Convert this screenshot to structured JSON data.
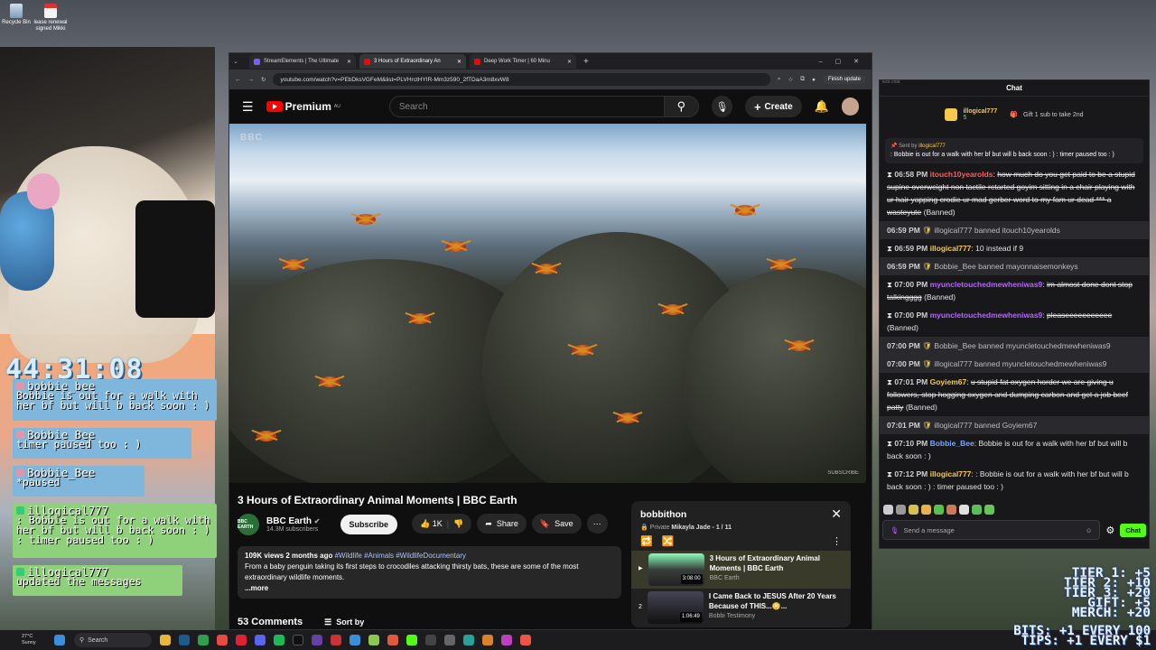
{
  "desktop": {
    "icons": [
      "Recycle Bin",
      "lease renewal signed Mikki"
    ]
  },
  "stream": {
    "timer": "44:31:08",
    "overlay_messages": [
      {
        "name": "bobbie_bee",
        "text": "Bobbie is out for a walk with her bf but will b back soon : )"
      },
      {
        "name": "Bobbie_Bee",
        "text": "timer paused too : )"
      },
      {
        "name": "Bobbie_Bee",
        "text": "*paused"
      },
      {
        "name": "illogical777",
        "text": ": Bobbie is out for a walk with her bf but will b back soon : ) : timer paused too : )"
      },
      {
        "name": "illogical777",
        "text": "updated the messages"
      }
    ],
    "tiers": [
      "TIER 1: +5",
      "TIER 2: +10",
      "TIER 3: +20",
      "GIFT: +5",
      "MERCH: +20"
    ],
    "bits": "BITS: +1 EVERY 100",
    "tips": "TIPS: +1 EVERY $1",
    "overlay_colors": {
      "blue": "#7fb6dc",
      "green": "#8fd07a"
    }
  },
  "browser": {
    "tabs": [
      {
        "label": "StreamElements | The Ultimate",
        "favcolor": "#7b5cff"
      },
      {
        "label": "3 Hours of Extraordinary An",
        "favcolor": "#ff0000"
      },
      {
        "label": "Deep Work Timer | 60 Minu",
        "favcolor": "#ff0000"
      }
    ],
    "url": "youtube.com/watch?v=PEbDksVGFeM&list=PLVHrctHYIR-Mm3z590_2fTDaA3m8xvW8",
    "finish_update": "Finish update"
  },
  "youtube": {
    "logo": "Premium",
    "region": "AU",
    "search_placeholder": "Search",
    "create_label": "Create",
    "video_watermark": "BBC",
    "video_subscribe": "SUBSCRIBE",
    "title": "3 Hours of Extraordinary Animal Moments | BBC Earth",
    "channel": "BBC Earth",
    "channel_avatar": "BBC EARTH",
    "subscribers": "14.3M subscribers",
    "subscribe_label": "Subscribe",
    "likes": "1K",
    "share_label": "Share",
    "save_label": "Save",
    "views": "109K views  2 months ago",
    "tags": "#Wildlife #Animals #WildlifeDocumentary",
    "description": "From a baby penguin taking its first steps to crocodiles attacking thirsty bats, these are some of the most extraordinary wildlife moments.",
    "more_label": "...more",
    "comments_label": "53 Comments",
    "sort_label": "Sort by",
    "playlist": {
      "title": "bobbithon",
      "private_label": "Private",
      "owner": "Mikayla Jade - 1 / 11",
      "items": [
        {
          "index": "▶",
          "title": "3 Hours of Extraordinary Animal Moments | BBC Earth",
          "channel": "BBC Earth",
          "duration": "3:08:00"
        },
        {
          "index": "2",
          "title": "I Came Back to JESUS After 20 Years Because of THIS...😳...",
          "channel": "Bobbi Testimony",
          "duration": "1:06:49"
        }
      ]
    }
  },
  "chat": {
    "kick_label": "kick chat",
    "title": "Chat",
    "gift_user": "illogical777",
    "gift_count": "5",
    "gift_text": "Gift 1 sub to take 2nd",
    "pinned_by_label": "Sent by",
    "pinned_by": "illogical777",
    "pinned_text": ": Bobbie is out for a walk with her bf but will b back soon : ) : timer paused too : )",
    "messages": [
      {
        "time": "06:58 PM",
        "user": "itouch10yearolds",
        "color": "#ff5a5a",
        "text": "how much do you get paid to be a stupid supine overweight non tactile retarted goyim sitting in a chair playing with ur hair yapping crodie ur mad gerber word to my fam ur dead *** a wasteyute",
        "suffix": "(Banned)",
        "strike": true,
        "mod": false
      },
      {
        "time": "06:59 PM",
        "user": "illogical777",
        "color": "#f7c948",
        "text": "banned itouch10yearolds",
        "suffix": "",
        "strike": false,
        "mod": true
      },
      {
        "time": "06:59 PM",
        "user": "illogical777",
        "color": "#f7c948",
        "text": "10 instead if 9",
        "suffix": "",
        "strike": false,
        "mod": false
      },
      {
        "time": "06:59 PM",
        "user": "Bobbie_Bee",
        "color": "#f7c948",
        "text": "banned mayonnaisemonkeys",
        "suffix": "",
        "strike": false,
        "mod": true
      },
      {
        "time": "07:00 PM",
        "user": "myuncletouchedmewheniwas9",
        "color": "#b466ff",
        "text": "im almost done dont stop talkingggg",
        "suffix": "(Banned)",
        "strike": true,
        "mod": false
      },
      {
        "time": "07:00 PM",
        "user": "myuncletouchedmewheniwas9",
        "color": "#b466ff",
        "text": "pleaseeeeeeeeeee",
        "suffix": "(Banned)",
        "strike": true,
        "mod": false
      },
      {
        "time": "07:00 PM",
        "user": "Bobbie_Bee",
        "color": "#f7c948",
        "text": "banned myuncletouchedmewheniwas9",
        "suffix": "",
        "strike": false,
        "mod": true
      },
      {
        "time": "07:00 PM",
        "user": "illogical777",
        "color": "#f7c948",
        "text": "banned myuncletouchedmewheniwas9",
        "suffix": "",
        "strike": false,
        "mod": true
      },
      {
        "time": "07:01 PM",
        "user": "Goyiem67",
        "color": "#f7c948",
        "text": "u stupid fat oxygen horder we are giving u followers, stop hogging oxygen and dumping carbon and get a job beef patty",
        "suffix": "(Banned)",
        "strike": true,
        "mod": false
      },
      {
        "time": "07:01 PM",
        "user": "illogical777",
        "color": "#f7c948",
        "text": "banned Goyiem67",
        "suffix": "",
        "strike": false,
        "mod": true
      },
      {
        "time": "07:10 PM",
        "user": "Bobbie_Bee",
        "color": "#7aa7ff",
        "text": "Bobbie is out for a walk with her bf but will b back soon : )",
        "suffix": "",
        "strike": false,
        "mod": false
      },
      {
        "time": "07:12 PM",
        "user": "illogical777",
        "color": "#f7c948",
        "text": ": Bobbie is out for a walk with her bf but will b back soon : ) : timer paused too : )",
        "suffix": "",
        "strike": false,
        "mod": false
      }
    ],
    "input_placeholder": "Send a message",
    "chat_button": "Chat"
  },
  "taskbar": {
    "weather_temp": "27°C",
    "weather_desc": "Sunny",
    "search_label": "Search"
  }
}
